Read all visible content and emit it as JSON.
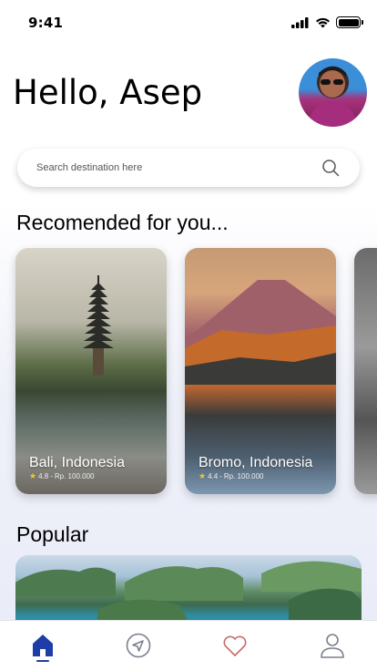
{
  "status_bar": {
    "time": "9:41"
  },
  "header": {
    "greeting": "Hello, Asep"
  },
  "search": {
    "placeholder": "Search destination here"
  },
  "recommended": {
    "title": "Recomended for you...",
    "cards": [
      {
        "name": "Bali, Indonesia",
        "rating": "4.8",
        "price": "Rp. 100.000"
      },
      {
        "name": "Bromo, Indonesia",
        "rating": "4.4",
        "price": "Rp. 100.000"
      }
    ]
  },
  "popular": {
    "title": "Popular"
  },
  "nav": {
    "items": [
      {
        "icon": "home-icon",
        "active": true
      },
      {
        "icon": "navigation-icon",
        "active": false
      },
      {
        "icon": "heart-icon",
        "active": false
      },
      {
        "icon": "user-icon",
        "active": false
      }
    ],
    "colors": {
      "active": "#1f3da6",
      "inactive": "#7a7f8c",
      "favorite": "#c76a6a"
    }
  }
}
